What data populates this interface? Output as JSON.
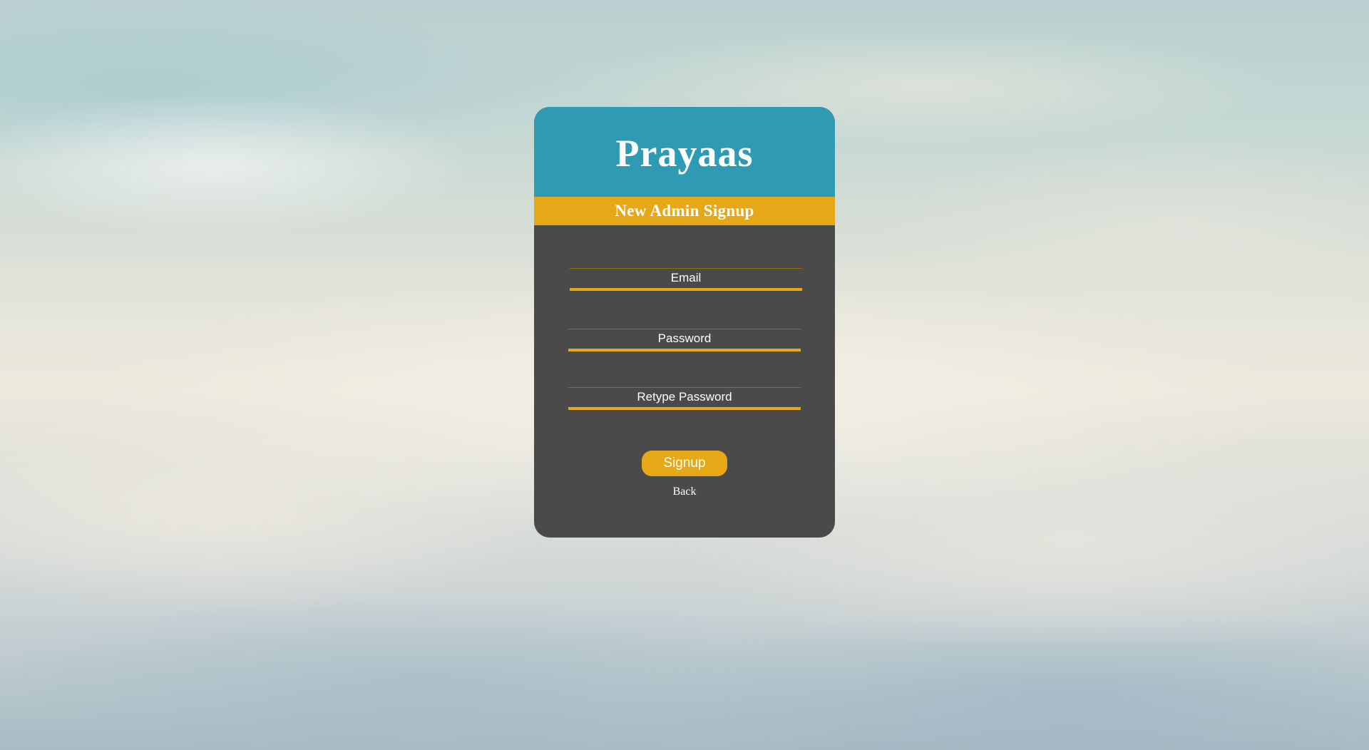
{
  "brand": {
    "title": "Prayaas"
  },
  "header": {
    "subtitle": "New Admin Signup"
  },
  "form": {
    "email": {
      "value": "",
      "placeholder": "Email"
    },
    "password": {
      "value": "",
      "placeholder": "Password"
    },
    "retype_password": {
      "value": "",
      "placeholder": "Retype Password"
    },
    "submit_label": "Signup",
    "back_label": "Back"
  },
  "colors": {
    "header_bg": "#2e9ab3",
    "accent": "#e6a816",
    "card_bg": "#4a4a4a"
  }
}
